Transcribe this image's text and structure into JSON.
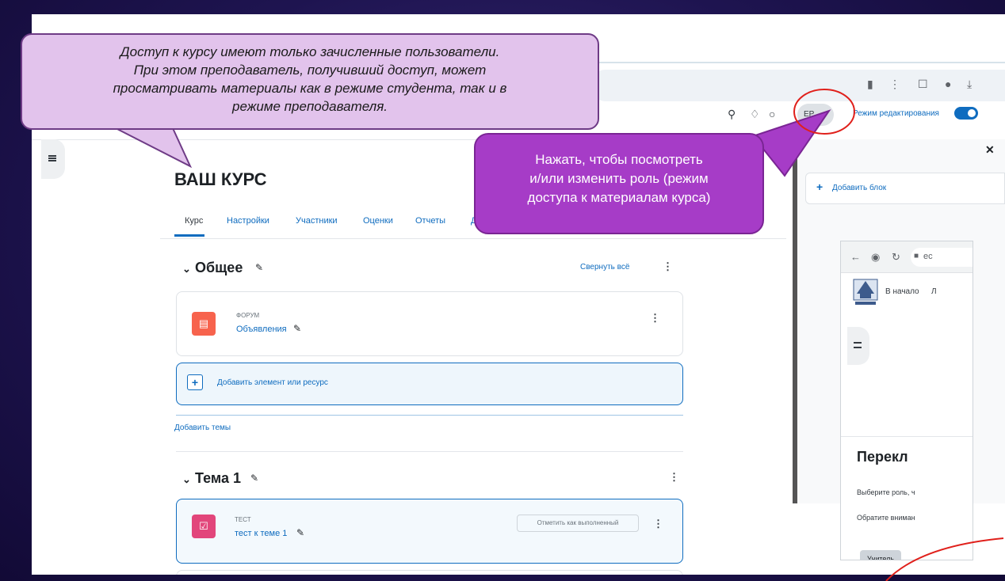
{
  "callouts": {
    "left": {
      "lines": [
        "Доступ к курсу имеют только зачисленные пользователи.",
        "При этом преподаватель, получивший доступ, может",
        "просматривать материалы как в режиме студента, так и в",
        "режиме преподавателя."
      ]
    },
    "purple": {
      "lines": [
        "Нажать, чтобы посмотреть",
        "и/или изменить роль (режим",
        "доступа к материалам курса)"
      ]
    }
  },
  "header": {
    "avatar_initials": "EP",
    "edit_mode_label": "Режим редактирования",
    "edit_mode_on": true
  },
  "course": {
    "title": "ВАШ КУРС",
    "tabs": [
      "Курс",
      "Настройки",
      "Участники",
      "Оценки",
      "Отчеты",
      "Д"
    ],
    "collapse_all": "Свернуть всё",
    "add_topics": "Добавить темы",
    "add_resource": "Добавить элемент или ресурс",
    "sections": [
      {
        "title": "Общее",
        "activity": {
          "type": "ФОРУМ",
          "name": "Объявления",
          "icon": "forum-icon",
          "color": "#f7634d"
        }
      },
      {
        "title": "Тема 1",
        "activity": {
          "type": "ТЕСТ",
          "name": "тест к теме 1",
          "icon": "quiz-icon",
          "color": "#e2467b"
        },
        "mark_done": "Отметить как выполненный"
      }
    ]
  },
  "block_drawer": {
    "add_block": "Добавить блок"
  },
  "mini": {
    "address_fragment": "ec",
    "nav_home": "В начало",
    "nav_more": "Л",
    "heading": "Перекл",
    "line1": "Выберите роль, ч",
    "line2": "Обратите вниман",
    "role_button": "Учитель"
  },
  "colors": {
    "accent": "#0f6cbf",
    "callout_purple": "#a63cc7",
    "callout_light": "#e2c3ec",
    "highlight_red": "#e0201b"
  }
}
